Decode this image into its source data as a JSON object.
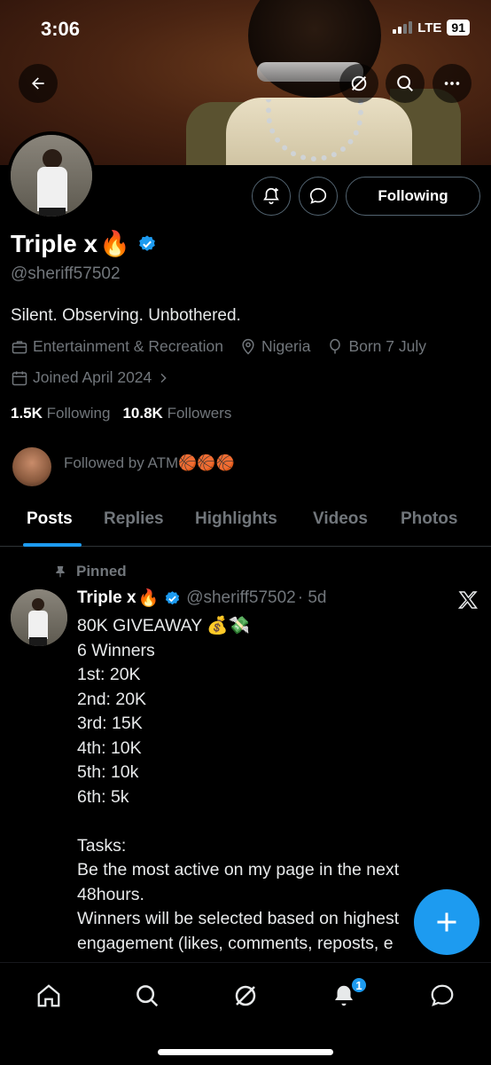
{
  "status_bar": {
    "time": "3:06",
    "network": "LTE",
    "battery": "91"
  },
  "profile": {
    "name": "Triple x",
    "name_emoji": "🔥",
    "handle": "@sheriff57502",
    "bio": "Silent. Observing. Unbothered.",
    "category": "Entertainment & Recreation",
    "location": "Nigeria",
    "birthday": "Born 7 July",
    "joined": "Joined April 2024",
    "following_count": "1.5K",
    "following_label": "Following",
    "followers_count": "10.8K",
    "followers_label": "Followers",
    "followed_by": "Followed by ATM🏀🏀🏀",
    "follow_button": "Following"
  },
  "tabs": [
    "Posts",
    "Replies",
    "Highlights",
    "Videos",
    "Photos"
  ],
  "active_tab": "Posts",
  "pinned_post": {
    "pinned_label": "Pinned",
    "author": "Triple x",
    "author_emoji": "🔥",
    "handle": "@sheriff57502",
    "time": "· 5d",
    "lines": [
      "80K GIVEAWAY 💰💸",
      "6 Winners",
      "1st: 20K",
      "2nd: 20K",
      "3rd: 15K",
      "4th: 10K",
      "5th: 10k",
      "6th: 5k",
      "",
      "Tasks:",
      "Be the most active on my page in the next",
      "48hours.",
      "Winners will be selected based on highest",
      "engagement (likes, comments, reposts, e"
    ]
  },
  "notifications_badge": "1",
  "colors": {
    "accent": "#1d9bf0",
    "muted": "#71767b",
    "background": "#000000"
  }
}
